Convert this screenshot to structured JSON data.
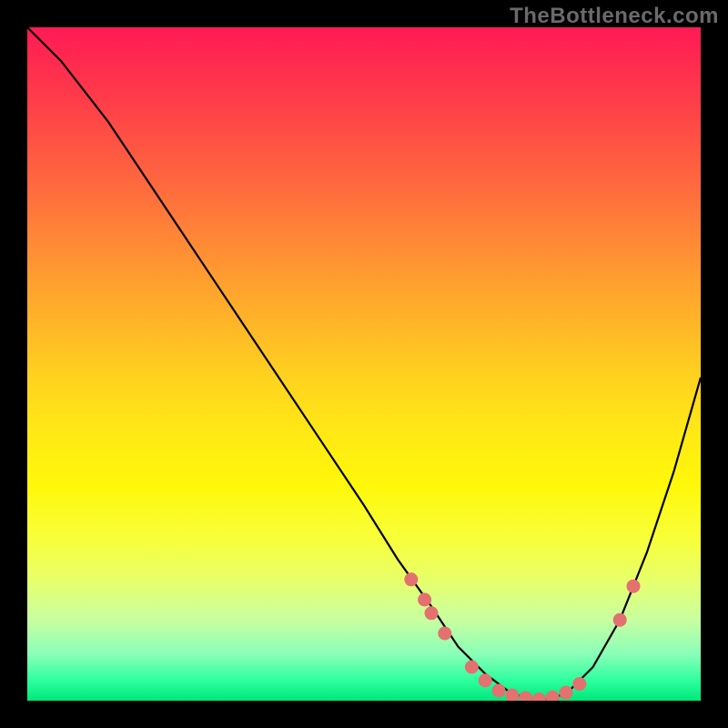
{
  "watermark": "TheBottleneck.com",
  "chart_data": {
    "type": "line",
    "title": "",
    "xlabel": "",
    "ylabel": "",
    "xlim": [
      0,
      100
    ],
    "ylim": [
      0,
      100
    ],
    "series": [
      {
        "name": "curve",
        "x": [
          0,
          5,
          12,
          20,
          28,
          36,
          44,
          50,
          55,
          60,
          64,
          68,
          72,
          76,
          80,
          84,
          88,
          92,
          96,
          100
        ],
        "y": [
          100,
          95,
          86,
          74,
          62,
          50,
          38,
          29,
          21,
          14,
          8,
          4,
          1,
          0,
          1,
          5,
          12,
          22,
          34,
          48
        ]
      }
    ],
    "markers": [
      {
        "x": 57,
        "y": 18
      },
      {
        "x": 59,
        "y": 15
      },
      {
        "x": 60,
        "y": 13
      },
      {
        "x": 62,
        "y": 10
      },
      {
        "x": 66,
        "y": 5
      },
      {
        "x": 68,
        "y": 3
      },
      {
        "x": 70,
        "y": 1.5
      },
      {
        "x": 72,
        "y": 0.8
      },
      {
        "x": 74,
        "y": 0.4
      },
      {
        "x": 76,
        "y": 0.2
      },
      {
        "x": 78,
        "y": 0.5
      },
      {
        "x": 80,
        "y": 1.2
      },
      {
        "x": 82,
        "y": 2.5
      },
      {
        "x": 88,
        "y": 12
      },
      {
        "x": 90,
        "y": 17
      }
    ],
    "colors": {
      "curve": "#000000",
      "markers": "#e2716f",
      "gradient_top": "#ff1a55",
      "gradient_bottom": "#00e77a"
    }
  }
}
